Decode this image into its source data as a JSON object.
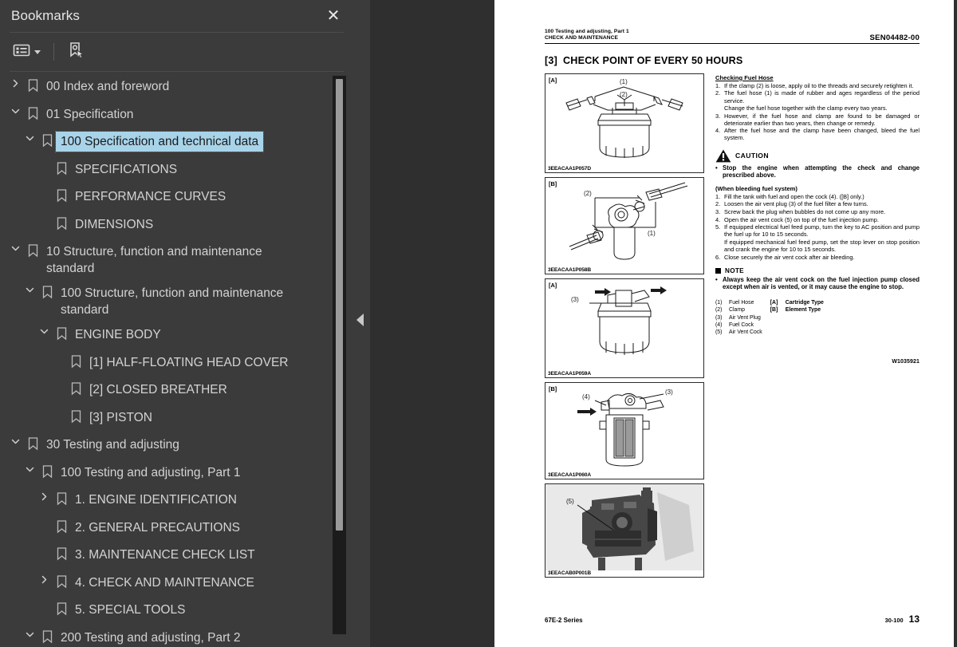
{
  "sidebar": {
    "title": "Bookmarks",
    "close_icon": "close-icon",
    "toolbar": {
      "list_options_icon": "list-options-icon",
      "new_bookmark_icon": "new-bookmark-icon"
    },
    "tree": [
      {
        "label": "00 Index and foreword",
        "depth": 0,
        "state": "collapsed",
        "selected": false
      },
      {
        "label": "01 Specification",
        "depth": 0,
        "state": "expanded",
        "selected": false
      },
      {
        "label": "100 Specification and technical data",
        "depth": 1,
        "state": "expanded",
        "selected": true
      },
      {
        "label": "SPECIFICATIONS",
        "depth": 2,
        "state": "leaf",
        "selected": false
      },
      {
        "label": "PERFORMANCE CURVES",
        "depth": 2,
        "state": "leaf",
        "selected": false
      },
      {
        "label": "DIMENSIONS",
        "depth": 2,
        "state": "leaf",
        "selected": false
      },
      {
        "label": "10 Structure, function and maintenance standard",
        "depth": 0,
        "state": "expanded",
        "selected": false
      },
      {
        "label": "100 Structure, function and maintenance standard",
        "depth": 1,
        "state": "expanded",
        "selected": false
      },
      {
        "label": "ENGINE BODY",
        "depth": 2,
        "state": "expanded",
        "selected": false
      },
      {
        "label": "[1] HALF-FLOATING HEAD COVER",
        "depth": 3,
        "state": "leaf",
        "selected": false
      },
      {
        "label": "[2] CLOSED BREATHER",
        "depth": 3,
        "state": "leaf",
        "selected": false
      },
      {
        "label": "[3] PISTON",
        "depth": 3,
        "state": "leaf",
        "selected": false
      },
      {
        "label": "30 Testing and adjusting",
        "depth": 0,
        "state": "expanded",
        "selected": false
      },
      {
        "label": "100 Testing and adjusting, Part 1",
        "depth": 1,
        "state": "expanded",
        "selected": false
      },
      {
        "label": "1. ENGINE IDENTIFICATION",
        "depth": 2,
        "state": "collapsed",
        "selected": false
      },
      {
        "label": "2. GENERAL PRECAUTIONS",
        "depth": 2,
        "state": "leaf",
        "selected": false
      },
      {
        "label": "3. MAINTENANCE CHECK LIST",
        "depth": 2,
        "state": "leaf",
        "selected": false
      },
      {
        "label": "4. CHECK AND MAINTENANCE",
        "depth": 2,
        "state": "collapsed",
        "selected": false
      },
      {
        "label": "5. SPECIAL TOOLS",
        "depth": 2,
        "state": "leaf",
        "selected": false
      },
      {
        "label": "200 Testing and adjusting, Part 2",
        "depth": 1,
        "state": "expanded",
        "selected": false
      }
    ],
    "selection_color": "#a8d4ea"
  },
  "gutter": {
    "collapse_handle_icon": "collapse-panel-icon",
    "cursor_icon": "mouse-pointer-icon"
  },
  "document": {
    "header": {
      "left_line1": "100 Testing and adjusting, Part 1",
      "left_line2": "CHECK AND MAINTENANCE",
      "right": "SEN04482-00"
    },
    "section_number": "[3]",
    "section_title": "CHECK POINT OF EVERY 50 HOURS",
    "figures": [
      {
        "tag": "[A]",
        "caption": "3EEACAA1P057D",
        "kind": "cartridge-filter-hoses",
        "callouts": [
          "(1)",
          "(2)"
        ]
      },
      {
        "tag": "[B]",
        "caption": "3EEACAA1P058B",
        "kind": "element-filter-hoses",
        "callouts": [
          "(1)",
          "(2)"
        ]
      },
      {
        "tag": "[A]",
        "caption": "3EEACAA1P059A",
        "kind": "cartridge-filter-vent",
        "callouts": [
          "(3)"
        ]
      },
      {
        "tag": "[B]",
        "caption": "3EEACAA1P060A",
        "kind": "element-filter-cock",
        "callouts": [
          "(3)",
          "(4)"
        ]
      },
      {
        "tag": "",
        "caption": "3EEACAB0P001B",
        "kind": "engine-photo",
        "callouts": [
          "(5)"
        ]
      }
    ],
    "body": {
      "heading": "Checking Fuel Hose",
      "steps": [
        {
          "num": "1.",
          "text": "If the clamp (2) is loose, apply oil to the threads and securely retighten it."
        },
        {
          "num": "2.",
          "text": "The fuel hose (1) is made of rubber and ages regardless of the period service."
        },
        {
          "num": "",
          "text": "Change the fuel hose together with the clamp every two years."
        },
        {
          "num": "3.",
          "text": "However, if the fuel hose and clamp are found to be damaged or deteriorate earlier than two years, then change or remedy."
        },
        {
          "num": "4.",
          "text": "After the fuel hose and the clamp have been changed, bleed the fuel system."
        }
      ],
      "caution": {
        "icon": "warning-triangle-icon",
        "word": "CAUTION",
        "bullet": "•",
        "text": "Stop the engine when attempting the check and change prescribed above."
      },
      "bleed_heading": "(When bleeding fuel system)",
      "bleed_steps": [
        {
          "num": "1.",
          "text": "Fill the tank with fuel and open the cock (4).  ([B] only.)"
        },
        {
          "num": "2.",
          "text": "Loosen the air vent plug (3) of the fuel filter a few turns."
        },
        {
          "num": "3.",
          "text": "Screw back the plug when bubbles do not come up any more."
        },
        {
          "num": "4.",
          "text": "Open the air vent cock (5) on top of the fuel injection pump."
        },
        {
          "num": "5.",
          "text": "If equipped electrical fuel feed pump, turn the key to AC position and pump the fuel up for 10 to 15 seconds."
        },
        {
          "num": "",
          "text": "If equipped mechanical fuel feed pump, set the stop lever on stop position and crank the engine for 10 to 15 seconds."
        },
        {
          "num": "6.",
          "text": "Close securely the air vent cock after air bleeding."
        }
      ],
      "note": {
        "word": "NOTE",
        "bullet": "•",
        "text": "Always keep the air vent cock on the fuel injection pump closed except when air is vented, or it may cause the engine to stop."
      },
      "legend_left": [
        {
          "key": "(1)",
          "value": "Fuel Hose"
        },
        {
          "key": "(2)",
          "value": "Clamp"
        },
        {
          "key": "(3)",
          "value": "Air Vent Plug"
        },
        {
          "key": "(4)",
          "value": "Fuel Cock"
        },
        {
          "key": "(5)",
          "value": "Air Vent Cock"
        }
      ],
      "legend_right": [
        {
          "key": "[A]",
          "value": "Cartridge Type"
        },
        {
          "key": "[B]",
          "value": "Element Type"
        }
      ],
      "figure_ref": "W1035921"
    },
    "footer": {
      "left": "67E-2 Series",
      "section": "30-100",
      "page": "13"
    }
  }
}
